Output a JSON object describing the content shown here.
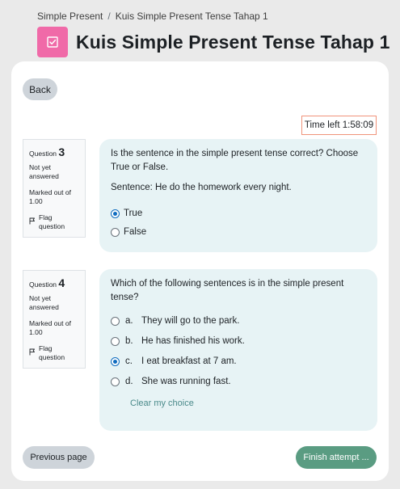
{
  "breadcrumb": {
    "items": [
      "Simple Present",
      "Kuis Simple Present Tense Tahap 1"
    ],
    "separator": "/"
  },
  "page_title": "Kuis Simple Present Tense Tahap 1",
  "icons": {
    "quiz": "quiz-checkbox-icon",
    "flag": "flag-icon"
  },
  "colors": {
    "quiz_icon_bg": "#f06aa8",
    "accent": "#0f6cbf",
    "finish_bg": "#5a9c82",
    "question_bg": "#e7f3f5",
    "timer_border": "#f0937a"
  },
  "buttons": {
    "back": "Back",
    "previous": "Previous page",
    "finish": "Finish attempt ..."
  },
  "timer": {
    "text": "Time left 1:58:09"
  },
  "questions": [
    {
      "label": "Question",
      "number": "3",
      "state": "Not yet answered",
      "grade": "Marked out of 1.00",
      "flag": "Flag question",
      "text": "Is the sentence in the simple present tense correct? Choose True or False.",
      "sub": "Sentence: He do the homework every night.",
      "options": [
        {
          "label": "True",
          "selected": true
        },
        {
          "label": "False",
          "selected": false
        }
      ]
    },
    {
      "label": "Question",
      "number": "4",
      "state": "Not yet answered",
      "grade": "Marked out of 1.00",
      "flag": "Flag question",
      "text": "Which of the following sentences is in the simple present tense?",
      "options": [
        {
          "letter": "a.",
          "text": "They will go to the park.",
          "selected": false
        },
        {
          "letter": "b.",
          "text": "He has finished his work.",
          "selected": false
        },
        {
          "letter": "c.",
          "text": "I eat breakfast at 7 am.",
          "selected": true
        },
        {
          "letter": "d.",
          "text": "She was running fast.",
          "selected": false
        }
      ],
      "clear": "Clear my choice"
    }
  ]
}
